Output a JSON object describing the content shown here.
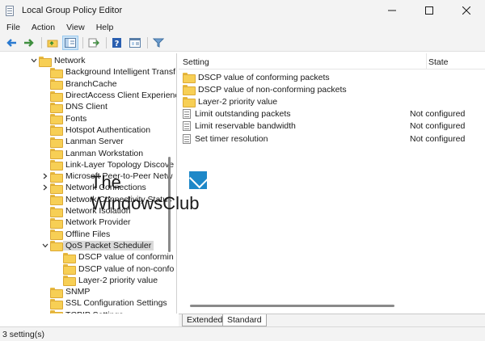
{
  "window": {
    "title": "Local Group Policy Editor"
  },
  "menu": [
    "File",
    "Action",
    "View",
    "Help"
  ],
  "toolbar": {
    "buttons": [
      "back-icon",
      "forward-icon",
      "up-folder-icon",
      "show-hide-tree-icon",
      "export-list-icon",
      "help-icon",
      "properties-icon",
      "filter-icon"
    ]
  },
  "tree": {
    "items": [
      {
        "label": "Network",
        "type": "folder",
        "expander": "expanded"
      },
      {
        "label": "Background Intelligent Transf",
        "type": "folder",
        "expander": ""
      },
      {
        "label": "BranchCache",
        "type": "folder",
        "expander": ""
      },
      {
        "label": "DirectAccess Client Experienc",
        "type": "folder",
        "expander": ""
      },
      {
        "label": "DNS Client",
        "type": "folder",
        "expander": ""
      },
      {
        "label": "Fonts",
        "type": "folder",
        "expander": ""
      },
      {
        "label": "Hotspot Authentication",
        "type": "folder",
        "expander": ""
      },
      {
        "label": "Lanman Server",
        "type": "folder",
        "expander": ""
      },
      {
        "label": "Lanman Workstation",
        "type": "folder",
        "expander": ""
      },
      {
        "label": "Link-Layer Topology Discove",
        "type": "folder",
        "expander": ""
      },
      {
        "label": "Microsoft Peer-to-Peer Netw",
        "type": "folder",
        "expander": "collapsed"
      },
      {
        "label": "Network Connections",
        "type": "folder",
        "expander": "collapsed"
      },
      {
        "label": "Network Connectivity Status",
        "type": "folder",
        "expander": ""
      },
      {
        "label": "Network Isolation",
        "type": "folder",
        "expander": ""
      },
      {
        "label": "Network Provider",
        "type": "folder",
        "expander": ""
      },
      {
        "label": "Offline Files",
        "type": "folder",
        "expander": ""
      },
      {
        "label": "QoS Packet Scheduler",
        "type": "folder",
        "expander": "expanded",
        "selected": true
      },
      {
        "label": "DSCP value of conformin",
        "type": "folder",
        "expander": ""
      },
      {
        "label": "DSCP value of non-confo",
        "type": "folder",
        "expander": ""
      },
      {
        "label": "Layer-2 priority value",
        "type": "folder",
        "expander": ""
      },
      {
        "label": "SNMP",
        "type": "folder",
        "expander": ""
      },
      {
        "label": "SSL Configuration Settings",
        "type": "folder",
        "expander": ""
      },
      {
        "label": "TCPIP Settings",
        "type": "folder",
        "expander": ""
      }
    ]
  },
  "list": {
    "columns": {
      "setting": "Setting",
      "state": "State"
    },
    "rows": [
      {
        "name": "DSCP value of conforming packets",
        "type": "folder",
        "state": ""
      },
      {
        "name": "DSCP value of non-conforming packets",
        "type": "folder",
        "state": ""
      },
      {
        "name": "Layer-2 priority value",
        "type": "folder",
        "state": ""
      },
      {
        "name": "Limit outstanding packets",
        "type": "policy",
        "state": "Not configured"
      },
      {
        "name": "Limit reservable bandwidth",
        "type": "policy",
        "state": "Not configured"
      },
      {
        "name": "Set timer resolution",
        "type": "policy",
        "state": "Not configured"
      }
    ]
  },
  "tabs": [
    "Extended",
    "Standard"
  ],
  "active_tab": "Standard",
  "status": "3 setting(s)",
  "watermark": {
    "line1": "The",
    "line2": "WindowsClub"
  },
  "colors": {
    "folder": "#f7cf55",
    "selection": "#d9d9d9",
    "chrome": "#f3f3f3",
    "accent": "#0067c0"
  }
}
